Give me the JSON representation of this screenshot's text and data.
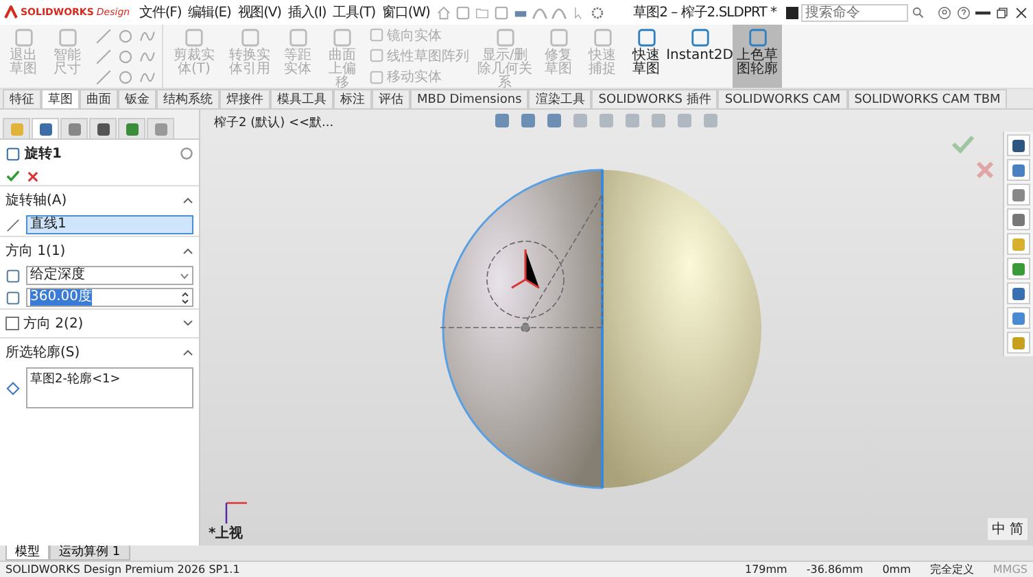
{
  "titlebar": {
    "logo": {
      "brand": "SOLIDWORKS",
      "product": "Design"
    },
    "menus": [
      "文件(F)",
      "编辑(E)",
      "视图(V)",
      "插入(I)",
      "工具(T)",
      "窗口(W)"
    ],
    "document_title": "草图2 – 榨子2.SLDPRT *",
    "search": {
      "placeholder": "搜索命令"
    }
  },
  "ribbon": {
    "items": [
      {
        "kind": "large",
        "label": "退出草图",
        "disabled": true,
        "selected": false
      },
      {
        "kind": "large",
        "label": "智能尺寸",
        "disabled": true,
        "selected": false
      },
      {
        "kind": "tools"
      },
      {
        "kind": "large",
        "label": "剪裁实体(T)",
        "disabled": true,
        "selected": false
      },
      {
        "kind": "large",
        "label": "转换实体引用",
        "disabled": true,
        "selected": false
      },
      {
        "kind": "large",
        "label": "等距实体",
        "disabled": true,
        "selected": false
      },
      {
        "kind": "large",
        "label": "曲面上偏移",
        "disabled": true,
        "selected": false
      },
      {
        "kind": "stack",
        "entries": [
          "镜向实体",
          "线性草图阵列",
          "移动实体"
        ],
        "disabled": true
      },
      {
        "kind": "large",
        "label": "显示/删除几何关系",
        "disabled": true,
        "selected": false
      },
      {
        "kind": "large",
        "label": "修复草图",
        "disabled": true,
        "selected": false
      },
      {
        "kind": "large",
        "label": "快速捕捉",
        "disabled": true,
        "selected": false
      },
      {
        "kind": "large",
        "label": "快速草图",
        "disabled": false,
        "selected": false
      },
      {
        "kind": "large",
        "label": "Instant2D",
        "disabled": false,
        "selected": false
      },
      {
        "kind": "large",
        "label": "上色草图轮廓",
        "disabled": false,
        "selected": true
      }
    ]
  },
  "tabs": [
    {
      "label": "特征",
      "selected": false
    },
    {
      "label": "草图",
      "selected": true
    },
    {
      "label": "曲面",
      "selected": false
    },
    {
      "label": "钣金",
      "selected": false
    },
    {
      "label": "结构系统",
      "selected": false
    },
    {
      "label": "焊接件",
      "selected": false
    },
    {
      "label": "模具工具",
      "selected": false
    },
    {
      "label": "标注",
      "selected": false
    },
    {
      "label": "评估",
      "selected": false
    },
    {
      "label": "MBD Dimensions",
      "selected": false
    },
    {
      "label": "渲染工具",
      "selected": false
    },
    {
      "label": "SOLIDWORKS 插件",
      "selected": false
    },
    {
      "label": "SOLIDWORKS CAM",
      "selected": false
    },
    {
      "label": "SOLIDWORKS CAM TBM",
      "selected": false
    }
  ],
  "property_manager": {
    "panel_tabs": [
      {
        "selected": false
      },
      {
        "selected": true
      },
      {
        "selected": false
      },
      {
        "selected": false
      },
      {
        "selected": false
      },
      {
        "selected": false
      }
    ],
    "title": "旋转1",
    "sections": [
      {
        "kind": "axis",
        "title": "旋转轴(A)",
        "expanded": true,
        "value": "直线1"
      },
      {
        "kind": "direction",
        "title": "方向 1(1)",
        "expanded": true,
        "type": "给定深度",
        "angle": "360.00度"
      },
      {
        "kind": "check",
        "title": "方向 2(2)",
        "expanded": false,
        "checked": false
      },
      {
        "kind": "list",
        "title": "所选轮廓(S)",
        "expanded": true,
        "value": "草图2-轮廓<1>"
      }
    ]
  },
  "viewport": {
    "breadcrumb": "榨子2 (默认) <<默...",
    "view_name": "*上视",
    "ime": [
      "中",
      "简"
    ]
  },
  "bottom_tabs": [
    {
      "label": "模型",
      "selected": true
    },
    {
      "label": "运动算例 1",
      "selected": false
    }
  ],
  "status_bar": {
    "product": "SOLIDWORKS Design Premium 2026 SP1.1",
    "x": "179mm",
    "y": "-36.86mm",
    "z": "0mm",
    "state": "完全定义",
    "units": "MMGS"
  }
}
